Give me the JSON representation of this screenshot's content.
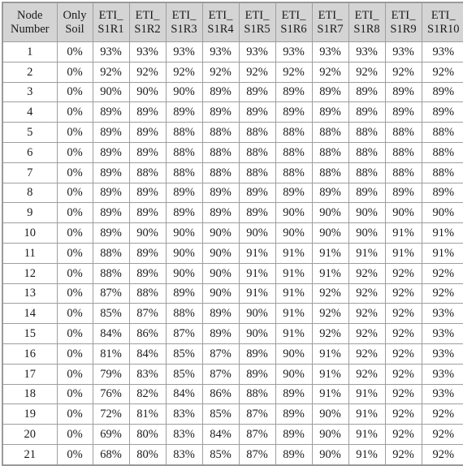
{
  "table": {
    "name": "node-eti-percentage-table",
    "columns": [
      {
        "id": "node_number",
        "line1": "Node",
        "line2": "Number"
      },
      {
        "id": "only_soil",
        "line1": "Only",
        "line2": "Soil"
      },
      {
        "id": "eti_s1r1",
        "line1": "ETI_",
        "line2": "S1R1"
      },
      {
        "id": "eti_s1r2",
        "line1": "ETI_",
        "line2": "S1R2"
      },
      {
        "id": "eti_s1r3",
        "line1": "ETI_",
        "line2": "S1R3"
      },
      {
        "id": "eti_s1r4",
        "line1": "ETI_",
        "line2": "S1R4"
      },
      {
        "id": "eti_s1r5",
        "line1": "ETI_",
        "line2": "S1R5"
      },
      {
        "id": "eti_s1r6",
        "line1": "ETI_",
        "line2": "S1R6"
      },
      {
        "id": "eti_s1r7",
        "line1": "ETI_",
        "line2": "S1R7"
      },
      {
        "id": "eti_s1r8",
        "line1": "ETI_",
        "line2": "S1R8"
      },
      {
        "id": "eti_s1r9",
        "line1": "ETI_",
        "line2": "S1R9"
      },
      {
        "id": "eti_s1r10",
        "line1": "ETI_",
        "line2": "S1R10"
      }
    ],
    "rows": [
      [
        "1",
        "0%",
        "93%",
        "93%",
        "93%",
        "93%",
        "93%",
        "93%",
        "93%",
        "93%",
        "93%",
        "93%"
      ],
      [
        "2",
        "0%",
        "92%",
        "92%",
        "92%",
        "92%",
        "92%",
        "92%",
        "92%",
        "92%",
        "92%",
        "92%"
      ],
      [
        "3",
        "0%",
        "90%",
        "90%",
        "90%",
        "89%",
        "89%",
        "89%",
        "89%",
        "89%",
        "89%",
        "89%"
      ],
      [
        "4",
        "0%",
        "89%",
        "89%",
        "89%",
        "89%",
        "89%",
        "89%",
        "89%",
        "89%",
        "89%",
        "89%"
      ],
      [
        "5",
        "0%",
        "89%",
        "89%",
        "88%",
        "88%",
        "88%",
        "88%",
        "88%",
        "88%",
        "88%",
        "88%"
      ],
      [
        "6",
        "0%",
        "89%",
        "89%",
        "88%",
        "88%",
        "88%",
        "88%",
        "88%",
        "88%",
        "88%",
        "88%"
      ],
      [
        "7",
        "0%",
        "89%",
        "88%",
        "88%",
        "88%",
        "88%",
        "88%",
        "88%",
        "88%",
        "88%",
        "88%"
      ],
      [
        "8",
        "0%",
        "89%",
        "89%",
        "89%",
        "89%",
        "89%",
        "89%",
        "89%",
        "89%",
        "89%",
        "89%"
      ],
      [
        "9",
        "0%",
        "89%",
        "89%",
        "89%",
        "89%",
        "89%",
        "90%",
        "90%",
        "90%",
        "90%",
        "90%"
      ],
      [
        "10",
        "0%",
        "89%",
        "90%",
        "90%",
        "90%",
        "90%",
        "90%",
        "90%",
        "90%",
        "91%",
        "91%"
      ],
      [
        "11",
        "0%",
        "88%",
        "89%",
        "90%",
        "90%",
        "91%",
        "91%",
        "91%",
        "91%",
        "91%",
        "91%"
      ],
      [
        "12",
        "0%",
        "88%",
        "89%",
        "90%",
        "90%",
        "91%",
        "91%",
        "91%",
        "92%",
        "92%",
        "92%"
      ],
      [
        "13",
        "0%",
        "87%",
        "88%",
        "89%",
        "90%",
        "91%",
        "91%",
        "92%",
        "92%",
        "92%",
        "92%"
      ],
      [
        "14",
        "0%",
        "85%",
        "87%",
        "88%",
        "89%",
        "90%",
        "91%",
        "92%",
        "92%",
        "92%",
        "93%"
      ],
      [
        "15",
        "0%",
        "84%",
        "86%",
        "87%",
        "89%",
        "90%",
        "91%",
        "92%",
        "92%",
        "92%",
        "93%"
      ],
      [
        "16",
        "0%",
        "81%",
        "84%",
        "85%",
        "87%",
        "89%",
        "90%",
        "91%",
        "92%",
        "92%",
        "93%"
      ],
      [
        "17",
        "0%",
        "79%",
        "83%",
        "85%",
        "87%",
        "89%",
        "90%",
        "91%",
        "92%",
        "92%",
        "93%"
      ],
      [
        "18",
        "0%",
        "76%",
        "82%",
        "84%",
        "86%",
        "88%",
        "89%",
        "91%",
        "91%",
        "92%",
        "93%"
      ],
      [
        "19",
        "0%",
        "72%",
        "81%",
        "83%",
        "85%",
        "87%",
        "89%",
        "90%",
        "91%",
        "92%",
        "92%"
      ],
      [
        "20",
        "0%",
        "69%",
        "80%",
        "83%",
        "84%",
        "87%",
        "89%",
        "90%",
        "91%",
        "92%",
        "92%"
      ],
      [
        "21",
        "0%",
        "68%",
        "80%",
        "83%",
        "85%",
        "87%",
        "89%",
        "90%",
        "91%",
        "92%",
        "92%"
      ]
    ]
  },
  "colors": {
    "header_background": "#d4d4d4",
    "border": "#9e9e9e",
    "outer_border": "#9a9a9a",
    "text": "#1a1a1a",
    "cell_background": "#ffffff"
  }
}
